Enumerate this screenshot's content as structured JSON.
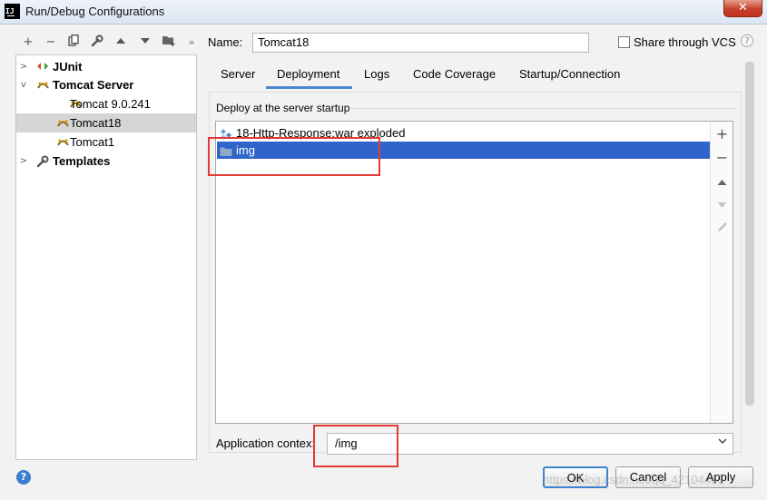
{
  "window": {
    "title": "Run/Debug Configurations",
    "app_icon_text": "IJ",
    "close_symbol": "✕"
  },
  "toolbar": [
    "plus-icon",
    "minus-icon",
    "copy-icon",
    "wrench-icon",
    "arrow-up-icon",
    "arrow-down-icon",
    "folder-add-icon",
    "more-icon"
  ],
  "tree": {
    "items": [
      {
        "label": "JUnit"
      },
      {
        "label": "Tomcat Server"
      },
      {
        "label": "Tomcat 9.0.241"
      },
      {
        "label": "Tomcat18"
      },
      {
        "label": "Tomcat1"
      },
      {
        "label": "Templates"
      }
    ]
  },
  "config": {
    "name_label": "Name:",
    "name_value": "Tomcat18",
    "share_label": "Share through VCS",
    "share_checked": false
  },
  "tabs": [
    {
      "label": "Server"
    },
    {
      "label": "Deployment",
      "active": true
    },
    {
      "label": "Logs"
    },
    {
      "label": "Code Coverage"
    },
    {
      "label": "Startup/Connection"
    }
  ],
  "deploy": {
    "title": "Deploy at the server startup",
    "items": [
      {
        "label": "18-Http-Response:war exploded",
        "icon": "artifact-icon",
        "selected": false
      },
      {
        "label": "img",
        "icon": "folder-icon",
        "selected": true
      }
    ],
    "tools": [
      "add-icon",
      "remove-icon",
      "move-up-icon",
      "move-down-icon",
      "edit-icon"
    ]
  },
  "context": {
    "label": "Application contex:",
    "value": "/img"
  },
  "buttons": {
    "ok": "OK",
    "cancel": "Cancel",
    "apply": "Apply",
    "help": "?"
  },
  "watermark": "https://blog.csdn.net/qq_42104463",
  "colors": {
    "selection": "#2f65ca",
    "tab_underline": "#4a88c7",
    "annotation": "#e53935"
  }
}
